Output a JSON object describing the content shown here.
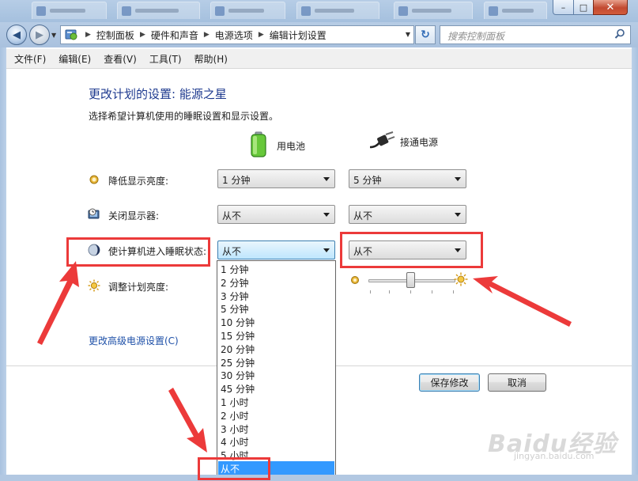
{
  "window": {
    "minimize_glyph": "–",
    "maximize_glyph": "□",
    "close_glyph": "✕"
  },
  "nav": {
    "back_glyph": "◀",
    "forward_glyph": "▶",
    "breadcrumbs": [
      {
        "label": "控制面板"
      },
      {
        "label": "硬件和声音"
      },
      {
        "label": "电源选项"
      },
      {
        "label": "编辑计划设置"
      }
    ],
    "refresh_glyph": "↻",
    "search_placeholder": "搜索控制面板"
  },
  "menubar": {
    "items": [
      {
        "label": "文件(F)"
      },
      {
        "label": "编辑(E)"
      },
      {
        "label": "查看(V)"
      },
      {
        "label": "工具(T)"
      },
      {
        "label": "帮助(H)"
      }
    ]
  },
  "page": {
    "title": "更改计划的设置: 能源之星",
    "subtitle": "选择希望计算机使用的睡眠设置和显示设置。",
    "columns": {
      "battery": "用电池",
      "plugged": "接通电源"
    }
  },
  "settings": {
    "dim_display": {
      "label": "降低显示亮度:",
      "battery": "1 分钟",
      "plugged": "5 分钟"
    },
    "turn_off_display": {
      "label": "关闭显示器:",
      "battery": "从不",
      "plugged": "从不"
    },
    "sleep": {
      "label": "使计算机进入睡眠状态:",
      "battery": "从不",
      "plugged": "从不"
    },
    "brightness": {
      "label": "调整计划亮度:",
      "plugged_level": 0.5
    }
  },
  "sleep_options": [
    "1 分钟",
    "2 分钟",
    "3 分钟",
    "5 分钟",
    "10 分钟",
    "15 分钟",
    "20 分钟",
    "25 分钟",
    "30 分钟",
    "45 分钟",
    "1 小时",
    "2 小时",
    "3 小时",
    "4 小时",
    "5 小时",
    "从不"
  ],
  "sleep_selected_index": 15,
  "links": {
    "advanced": "更改高级电源设置(C)"
  },
  "buttons": {
    "save": "保存修改",
    "cancel": "取消"
  },
  "watermark": {
    "logo": "Baidu经验",
    "url": "jingyan.baidu.com"
  },
  "colors": {
    "accent_title": "#1e3a8f",
    "link": "#1e50a8",
    "annotation": "#ec3a3a",
    "selection": "#3399ff"
  }
}
